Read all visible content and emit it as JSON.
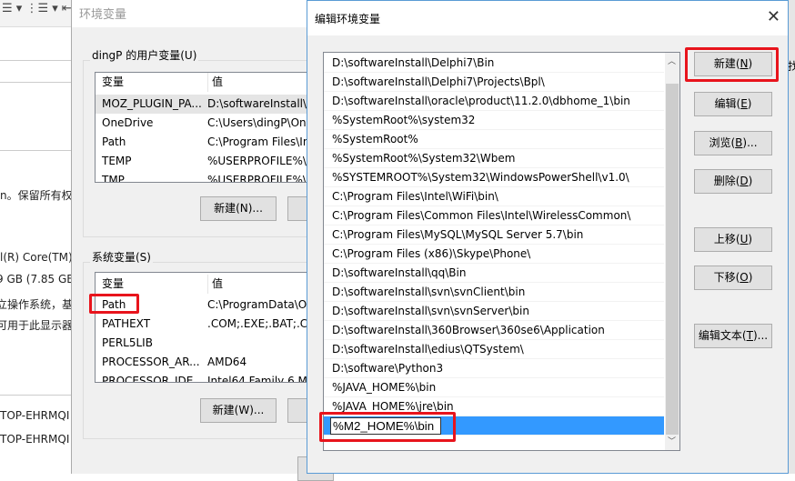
{
  "background_doc": {
    "toolbar": "☰ ▾ ⋮☰ ▾ ⇤☰",
    "lines": [
      "n。保留所有权",
      "l(R) Core(TM)",
      "9 GB (7.85 GB",
      "立操作系统，基",
      "可用于此显示器",
      "TOP-EHRMQI",
      "TOP-EHRMQI"
    ]
  },
  "env_dialog": {
    "title": "环境变量",
    "user_group": {
      "label": "dingP 的用户变量(U)",
      "col_var": "变量",
      "col_val": "值",
      "rows": [
        [
          "MOZ_PLUGIN_PA...",
          "D:\\softwareInstall\\p"
        ],
        [
          "OneDrive",
          "C:\\Users\\dingP\\On"
        ],
        [
          "Path",
          "C:\\Program Files\\In"
        ],
        [
          "TEMP",
          "%USERPROFILE%\\A"
        ],
        [
          "TMP",
          "%USERPROFILE%\\A"
        ]
      ],
      "new_button": "新建(N)..."
    },
    "system_group": {
      "label": "系统变量(S)",
      "col_var": "变量",
      "col_val": "值",
      "rows": [
        [
          "Path",
          "C:\\ProgramData\\O"
        ],
        [
          "PATHEXT",
          ".COM;.EXE;.BAT;.CM"
        ],
        [
          "PERL5LIB",
          ""
        ],
        [
          "PROCESSOR_AR...",
          "AMD64"
        ],
        [
          "PROCESSOR_IDE...",
          "Intel64 Family 6 Mo"
        ]
      ],
      "new_button": "新建(W)..."
    }
  },
  "edit_dialog": {
    "title": "编辑环境变量",
    "close": "✕",
    "paths": [
      "D:\\softwareInstall\\Delphi7\\Bin",
      "D:\\softwareInstall\\Delphi7\\Projects\\Bpl\\",
      "D:\\softwareInstall\\oracle\\product\\11.2.0\\dbhome_1\\bin",
      "%SystemRoot%\\system32",
      "%SystemRoot%",
      "%SystemRoot%\\System32\\Wbem",
      "%SYSTEMROOT%\\System32\\WindowsPowerShell\\v1.0\\",
      "C:\\Program Files\\Intel\\WiFi\\bin\\",
      "C:\\Program Files\\Common Files\\Intel\\WirelessCommon\\",
      "C:\\Program Files\\MySQL\\MySQL Server 5.7\\bin",
      "C:\\Program Files (x86)\\Skype\\Phone\\",
      "D:\\softwareInstall\\qq\\Bin",
      "D:\\softwareInstall\\svn\\svnClient\\bin",
      "D:\\softwareInstall\\svn\\svnServer\\bin",
      "D:\\softwareInstall\\360Browser\\360se6\\Application",
      "D:\\softwareInstall\\edius\\QTSystem\\",
      "D:\\software\\Python3",
      "%JAVA_HOME%\\bin",
      "%JAVA_HOME%\\jre\\bin"
    ],
    "editing_value": "%M2_HOME%\\bin",
    "buttons": {
      "new": {
        "text": "新建(",
        "key": "N",
        "end": ")"
      },
      "edit": {
        "text": "编辑(",
        "key": "E",
        "end": ")"
      },
      "browse": {
        "text": "浏览(",
        "key": "B",
        "end": ")..."
      },
      "delete": {
        "text": "删除(",
        "key": "D",
        "end": ")"
      },
      "up": {
        "text": "上移(",
        "key": "U",
        "end": ")"
      },
      "down": {
        "text": "下移(",
        "key": "O",
        "end": ")"
      },
      "edit_text": {
        "text": "编辑文本(",
        "key": "T",
        "end": ")..."
      }
    },
    "right_edge_text": "找",
    "highlight_color": "#e8141c",
    "selection_color": "#3399ff"
  }
}
